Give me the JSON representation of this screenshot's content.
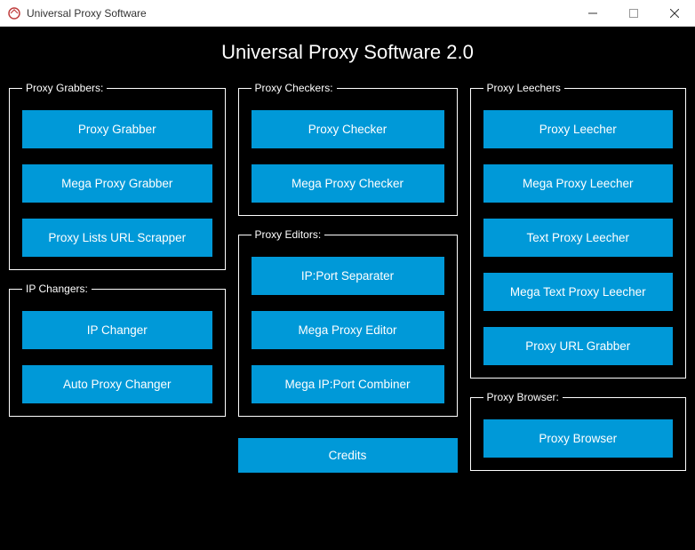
{
  "window": {
    "title": "Universal Proxy Software"
  },
  "app": {
    "title": "Universal Proxy Software 2.0"
  },
  "groups": {
    "proxyGrabbers": {
      "legend": "Proxy Grabbers:",
      "btn1": "Proxy Grabber",
      "btn2": "Mega Proxy Grabber",
      "btn3": "Proxy Lists URL Scrapper"
    },
    "ipChangers": {
      "legend": "IP Changers:",
      "btn1": "IP Changer",
      "btn2": "Auto Proxy Changer"
    },
    "proxyCheckers": {
      "legend": "Proxy Checkers:",
      "btn1": "Proxy Checker",
      "btn2": "Mega Proxy Checker"
    },
    "proxyEditors": {
      "legend": "Proxy Editors:",
      "btn1": "IP:Port Separater",
      "btn2": "Mega Proxy Editor",
      "btn3": "Mega IP:Port Combiner"
    },
    "proxyLeechers": {
      "legend": "Proxy Leechers",
      "btn1": "Proxy Leecher",
      "btn2": "Mega Proxy Leecher",
      "btn3": "Text Proxy Leecher",
      "btn4": "Mega Text Proxy Leecher",
      "btn5": "Proxy URL Grabber"
    },
    "proxyBrowser": {
      "legend": "Proxy Browser:",
      "btn1": "Proxy Browser"
    }
  },
  "footer": {
    "credits": "Credits"
  }
}
